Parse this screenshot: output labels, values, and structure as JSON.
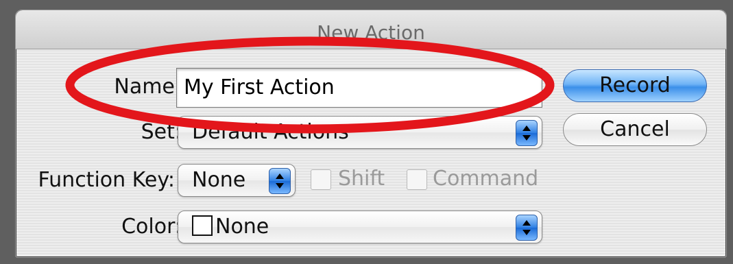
{
  "dialog": {
    "title": "New Action",
    "name_label": "Name:",
    "name_value": "My First Action",
    "set_label": "Set:",
    "set_value": "Default Actions",
    "function_key_label": "Function Key:",
    "function_key_value": "None",
    "shift_label": "Shift",
    "command_label": "Command",
    "color_label": "Color:",
    "color_value": "None",
    "record_button": "Record",
    "cancel_button": "Cancel"
  },
  "colors": {
    "annotation": "#e3161b",
    "default_button": "#3b8fe9"
  },
  "icons": {
    "stepper": "up-down-arrows-icon",
    "swatch": "white-color-swatch-icon"
  }
}
